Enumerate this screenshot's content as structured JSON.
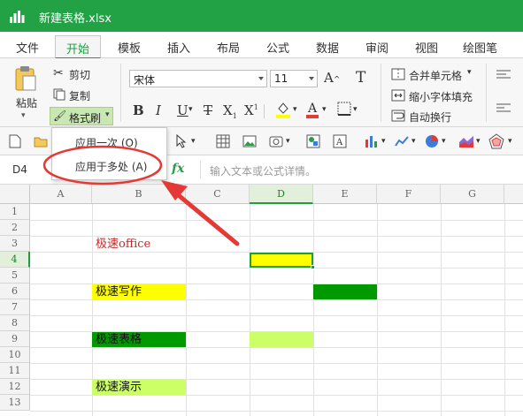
{
  "window": {
    "title": "新建表格.xlsx"
  },
  "tabs": [
    "文件",
    "开始",
    "模板",
    "插入",
    "布局",
    "公式",
    "数据",
    "审阅",
    "视图",
    "绘图笔"
  ],
  "active_tab": "开始",
  "ribbon": {
    "paste": "粘贴",
    "cut": "剪切",
    "copy": "复制",
    "format_painter": "格式刷",
    "font_name": "宋体",
    "font_size": "11",
    "merge_center": "合并单元格",
    "shrink_fit": "缩小字体填充",
    "wrap_text": "自动换行"
  },
  "dropdown": {
    "apply_once": "应用一次 (O)",
    "apply_multiple": "应用于多处 (A)"
  },
  "formula_bar": {
    "cell_ref": "D4",
    "fx": "fx",
    "placeholder": "输入文本或公式详情。"
  },
  "columns": [
    "A",
    "B",
    "C",
    "D",
    "E",
    "F",
    "G"
  ],
  "rows": [
    "1",
    "2",
    "3",
    "4",
    "5",
    "6",
    "7",
    "8",
    "9",
    "10",
    "11",
    "12",
    "13"
  ],
  "cells": {
    "b3": "极速office",
    "b6": "极速写作",
    "b9": "极速表格",
    "b12": "极速演示"
  },
  "colors": {
    "brand_green": "#22a245",
    "yellow": "#ffff00",
    "dark_green": "#009900",
    "light_green": "#ccff66",
    "annotation_red": "#e53935"
  }
}
